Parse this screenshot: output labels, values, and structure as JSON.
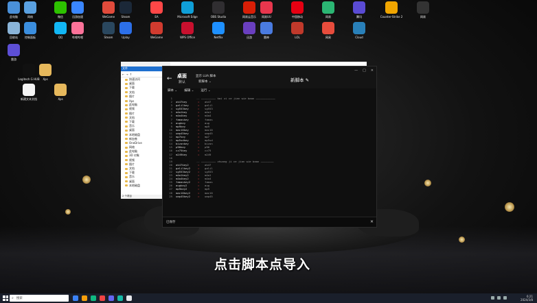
{
  "desktop_icons": [
    {
      "label": "此电脑",
      "color": "#4a90d9"
    },
    {
      "label": "网络",
      "color": "#5aa0e0"
    },
    {
      "label": "微信",
      "color": "#2dc100"
    },
    {
      "label": "迅游加速",
      "color": "#3a86ff"
    },
    {
      "label": "WeGame",
      "color": "#e14b3b"
    },
    {
      "label": "Steam",
      "color": "#1b2838"
    },
    {
      "label": "EA",
      "color": "#ff4747"
    },
    {
      "label": "Microsoft Edge",
      "color": "#0f9fd8"
    },
    {
      "label": "OBS Studio",
      "color": "#302e31"
    },
    {
      "label": "网易云音乐",
      "color": "#d81e06"
    },
    {
      "label": "网易UU",
      "color": "#e8364d"
    },
    {
      "label": "中国移动",
      "color": "#e60012"
    },
    {
      "label": "网易",
      "color": "#2bb673"
    },
    {
      "label": "腾讯",
      "color": "#5a4bd4"
    },
    {
      "label": "Counter-Strike 2",
      "color": "#f0a500"
    },
    {
      "label": "网易",
      "color": "#333333"
    },
    {
      "label": "回收站",
      "color": "#8ab4d8"
    },
    {
      "label": "控制面板",
      "color": "#3b8ede"
    },
    {
      "label": "QQ",
      "color": "#12b7f5"
    },
    {
      "label": "哔哩哔哩",
      "color": "#fb7299"
    },
    {
      "label": "Steam",
      "color": "#2a475e"
    },
    {
      "label": "Uplay",
      "color": "#2c6fe8"
    },
    {
      "label": "WeGame",
      "color": "#d13b2f"
    },
    {
      "label": "WPS Office",
      "color": "#c8102e"
    },
    {
      "label": "Netflix",
      "color": "#1e90ff"
    },
    {
      "label": "迅游",
      "color": "#6a3fbf"
    },
    {
      "label": "雷神",
      "color": "#4a7be0"
    },
    {
      "label": "LOL",
      "color": "#c0392b"
    },
    {
      "label": "网易",
      "color": "#e74c3c"
    },
    {
      "label": "Cloud",
      "color": "#2980b9"
    },
    {
      "label": "雷游",
      "color": "#5d4fd6"
    },
    {
      "label": "Logitech G HUB",
      "color": "#111111"
    },
    {
      "label": "Xps",
      "color": "#e6b85c"
    },
    {
      "label": "新建文本文档",
      "color": "#f5f5f5"
    },
    {
      "label": "Xps",
      "color": "#e6b85c"
    },
    {
      "label": "文件夹",
      "color": "#e6b85c"
    }
  ],
  "explorer": {
    "ribbon_tab": "文件",
    "items": [
      "快速访问",
      "桌面",
      "下载",
      "文档",
      "图片",
      "Xps",
      "此电脑",
      "视频",
      "图片",
      "文档",
      "下载",
      "音乐",
      "桌面",
      "本地磁盘",
      "新加卷",
      "OneDrive",
      "网络",
      "此电脑",
      "3D 对象",
      "视频",
      "图片",
      "文档",
      "下载",
      "音乐",
      "桌面",
      "本地磁盘",
      "新加卷"
    ],
    "status": "2 个项目"
  },
  "editor": {
    "title": "桌面",
    "subtitle": "默认",
    "tag": "显示 LUA 脚本",
    "dropdown": "新脚本",
    "new_script": "新脚本",
    "menu": [
      "脚本",
      "编辑",
      "运行"
    ],
    "section1": "-- ————————— kai zi ce jian wie baan ————————————",
    "section2": "-- ————————— zhuang ji ce jian wie baan ————————",
    "lines": [
      {
        "n": "1",
        "k": "",
        "v": "",
        "c": "section1"
      },
      {
        "n": "2",
        "k": "ak47key",
        "v": "ak47"
      },
      {
        "n": "3",
        "k": "galilkey",
        "v": "galil"
      },
      {
        "n": "4",
        "k": "sg553key",
        "v": "sg553"
      },
      {
        "n": "5",
        "k": "m4a1key",
        "v": "m4a1"
      },
      {
        "n": "6",
        "k": "m4a4key",
        "v": "m4a4"
      },
      {
        "n": "7",
        "k": "famaskey",
        "v": "famas"
      },
      {
        "n": "8",
        "k": "augkey",
        "v": "aug"
      },
      {
        "n": "9",
        "k": "mp9key",
        "v": "mp9"
      },
      {
        "n": "10",
        "k": "mac10key",
        "v": "mac10"
      },
      {
        "n": "11",
        "k": "ump45key",
        "v": "ump45"
      },
      {
        "n": "12",
        "k": "mp7key",
        "v": "mp7"
      },
      {
        "n": "13",
        "k": "mp5sdkey",
        "v": "mp5sd"
      },
      {
        "n": "14",
        "k": "bizonkey",
        "v": "bizon"
      },
      {
        "n": "15",
        "k": "p90key",
        "v": "p90"
      },
      {
        "n": "16",
        "k": "cz75key",
        "v": "cz75"
      },
      {
        "n": "17",
        "k": "m249key",
        "v": "m249"
      },
      {
        "n": "18",
        "k": "",
        "v": ""
      },
      {
        "n": "19",
        "k": "",
        "v": "",
        "c": "section2"
      },
      {
        "n": "20",
        "k": "ak47key2",
        "v": "ak47"
      },
      {
        "n": "21",
        "k": "galilkey2",
        "v": "galil"
      },
      {
        "n": "22",
        "k": "sg553key2",
        "v": "sg553"
      },
      {
        "n": "23",
        "k": "m4a1key2",
        "v": "m4a1"
      },
      {
        "n": "24",
        "k": "m4a4key2",
        "v": "m4a4"
      },
      {
        "n": "25",
        "k": "famaskey2",
        "v": "famas"
      },
      {
        "n": "26",
        "k": "augkey2",
        "v": "aug"
      },
      {
        "n": "27",
        "k": "mp9key2",
        "v": "mp9"
      },
      {
        "n": "28",
        "k": "mac10key2",
        "v": "mac10"
      },
      {
        "n": "29",
        "k": "ump45key2",
        "v": "ump45"
      }
    ],
    "footer": "已保存"
  },
  "caption": "点击脚本点导入",
  "taskbar": {
    "search_placeholder": "搜索",
    "time": "6:21",
    "date": "2024/3/8",
    "apps": [
      "#3b82f6",
      "#f59e0b",
      "#10b981",
      "#ef4444",
      "#6366f1",
      "#14b8a6",
      "#e5e7eb"
    ]
  }
}
